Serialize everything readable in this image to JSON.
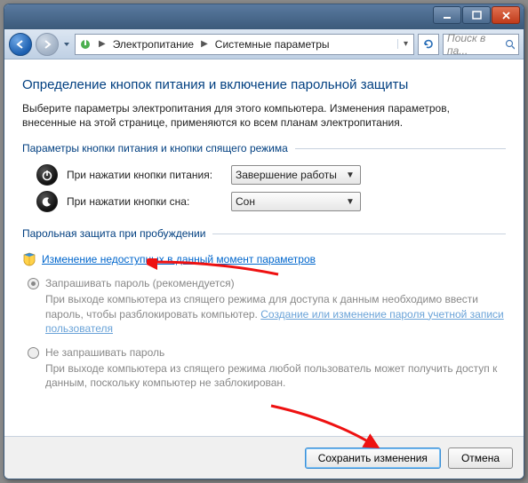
{
  "titlebar": {
    "minimize": "Свернуть",
    "maximize": "Развернуть",
    "close": "Закрыть"
  },
  "nav": {
    "back": "Назад",
    "forward": "Вперёд"
  },
  "breadcrumb": {
    "icon": "power-icon",
    "items": [
      "Электропитание",
      "Системные параметры"
    ]
  },
  "refresh_tooltip": "Обновить",
  "search": {
    "placeholder": "Поиск в па..."
  },
  "page": {
    "title": "Определение кнопок питания и включение парольной защиты",
    "description": "Выберите параметры электропитания для этого компьютера. Изменения параметров, внесенные на этой странице, применяются ко всем планам электропитания."
  },
  "group1": {
    "title": "Параметры кнопки питания и кнопки спящего режима",
    "power_label": "При нажатии кнопки питания:",
    "power_value": "Завершение работы",
    "sleep_label": "При нажатии кнопки сна:",
    "sleep_value": "Сон"
  },
  "group2": {
    "title": "Парольная защита при пробуждении",
    "change_link": "Изменение недоступных в данный момент параметров",
    "opt1": {
      "label": "Запрашивать пароль (рекомендуется)",
      "desc_before": "При выходе компьютера из спящего режима для доступа к данным необходимо ввести пароль, чтобы разблокировать компьютер. ",
      "desc_link": "Создание или изменение пароля учетной записи пользователя"
    },
    "opt2": {
      "label": "Не запрашивать пароль",
      "desc": "При выходе компьютера из спящего режима любой пользователь может получить доступ к данным, поскольку компьютер не заблокирован."
    }
  },
  "footer": {
    "save": "Сохранить изменения",
    "cancel": "Отмена"
  }
}
